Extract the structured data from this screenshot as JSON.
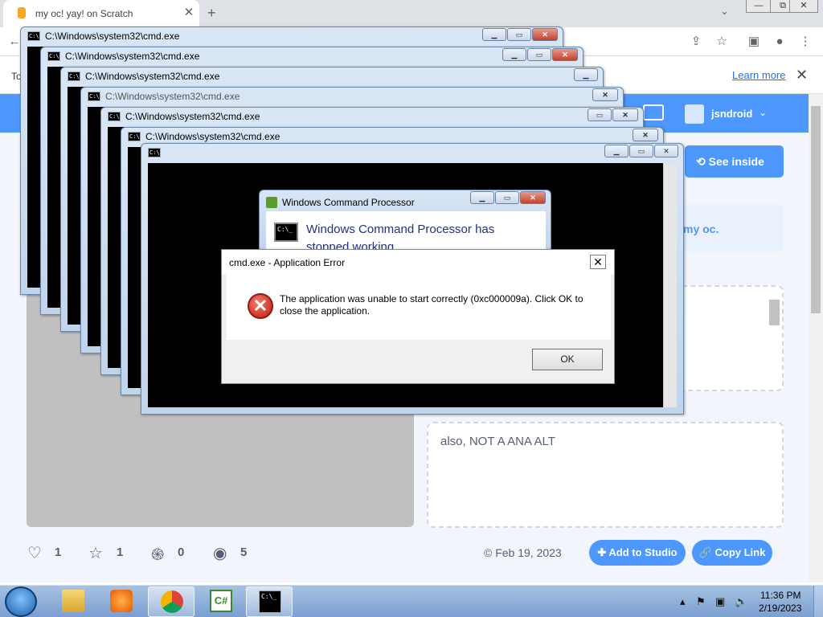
{
  "browser": {
    "tab_title": "my oc! yay! on Scratch",
    "tab_close": "✕",
    "new_tab": "+",
    "tab_list": "⌄",
    "window_min": "—",
    "window_max": "⧉",
    "window_close": "✕",
    "infobar_prefix": "To",
    "infobar_learn_more": "Learn more",
    "infobar_close": "✕"
  },
  "scratch": {
    "username": "jsndroid",
    "see_inside": "See inside",
    "notes_snippet": "my oc.",
    "notes_text": "also, NOT A ANA ALT",
    "stats": {
      "loves": "1",
      "favorites": "1",
      "remixes": "0",
      "views": "5"
    },
    "date": "© Feb 19, 2023",
    "add_to_studio": "Add to Studio",
    "copy_link": "Copy Link"
  },
  "cmd_windows": [
    {
      "title": "C:\\Windows\\system32\\cmd.exe"
    },
    {
      "title": "C:\\Windows\\system32\\cmd.exe"
    },
    {
      "title": "C:\\Windows\\system32\\cmd.exe"
    },
    {
      "title": "C:\\Windows\\system32\\cmd.exe"
    },
    {
      "title": "C:\\Windows\\system32\\cmd.exe"
    },
    {
      "title": "C:\\Windows\\system32\\cmd.exe"
    },
    {
      "title": ""
    }
  ],
  "wcp_dialog": {
    "title": "Windows Command Processor",
    "heading": "Windows Command Processor has stopped working"
  },
  "app_error": {
    "title": "cmd.exe - Application Error",
    "close": "✕",
    "message": "The application was unable to start correctly (0xc000009a). Click OK to close the application.",
    "ok": "OK"
  },
  "taskbar": {
    "time": "11:36 PM",
    "date": "2/19/2023",
    "items": [
      {
        "name": "windows-explorer",
        "icon": "folder-icon"
      },
      {
        "name": "media-player",
        "icon": "media-player-icon"
      },
      {
        "name": "chrome",
        "icon": "chrome-icon"
      },
      {
        "name": "csharp",
        "icon": "csharp-icon"
      },
      {
        "name": "cmd",
        "icon": "cmd-icon"
      }
    ]
  },
  "colors": {
    "scratch_blue": "#4d97ff",
    "taskbar": "#7b9ed1",
    "error_red": "#c0180c"
  }
}
